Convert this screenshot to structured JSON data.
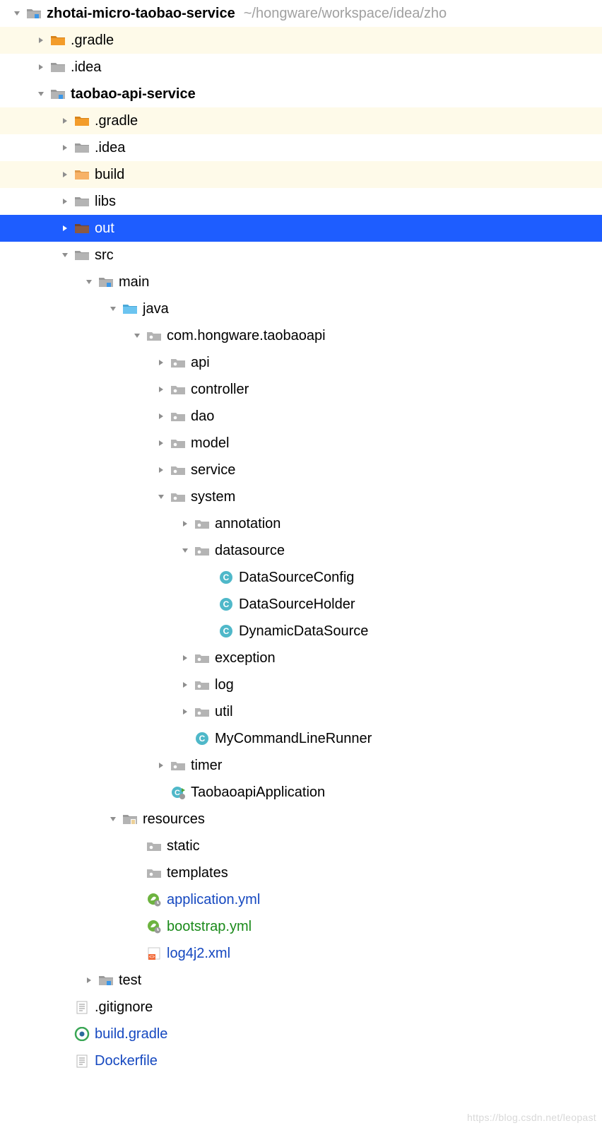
{
  "root": {
    "name": "zhotai-micro-taobao-service",
    "path_hint": "~/hongware/workspace/idea/zho"
  },
  "nodes": {
    "gradle1": ".gradle",
    "idea1": ".idea",
    "taobao_api_service": "taobao-api-service",
    "gradle2": ".gradle",
    "idea2": ".idea",
    "build": "build",
    "libs": "libs",
    "out": "out",
    "src": "src",
    "main": "main",
    "java": "java",
    "pkg": "com.hongware.taobaoapi",
    "api": "api",
    "controller": "controller",
    "dao": "dao",
    "model": "model",
    "service": "service",
    "system": "system",
    "annotation": "annotation",
    "datasource": "datasource",
    "DataSourceConfig": "DataSourceConfig",
    "DataSourceHolder": "DataSourceHolder",
    "DynamicDataSource": "DynamicDataSource",
    "exception": "exception",
    "log": "log",
    "util": "util",
    "MyCommandLineRunner": "MyCommandLineRunner",
    "timer": "timer",
    "TaobaoapiApplication": "TaobaoapiApplication",
    "resources": "resources",
    "static": "static",
    "templates": "templates",
    "application_yml": "application.yml",
    "bootstrap_yml": "bootstrap.yml",
    "log4j2_xml": "log4j2.xml",
    "test": "test",
    "gitignore": ".gitignore",
    "build_gradle": "build.gradle",
    "Dockerfile": "Dockerfile"
  },
  "watermark": "https://blog.csdn.net/leopast"
}
